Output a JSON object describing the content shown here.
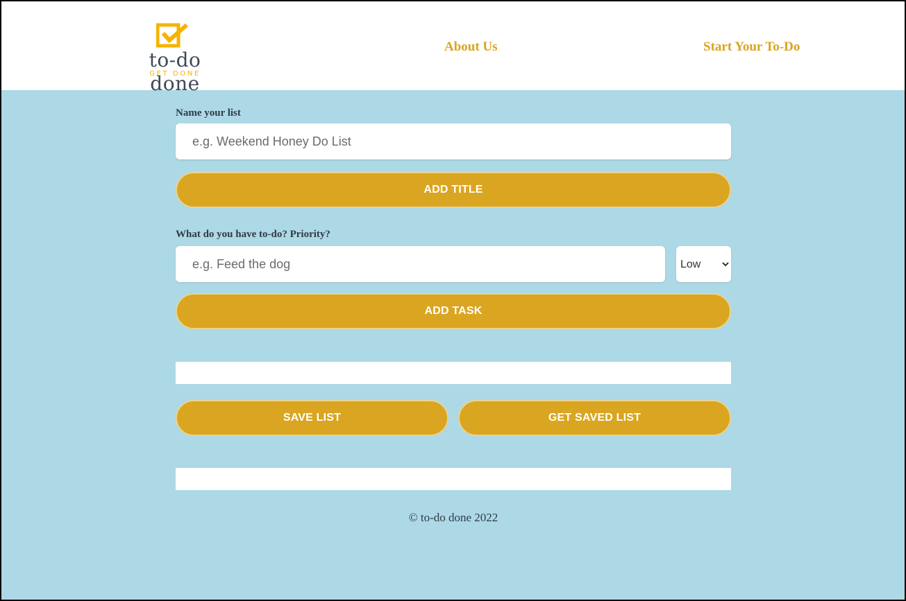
{
  "header": {
    "logo": {
      "name": "to-do done",
      "tagline": "GET DONE",
      "color_mark": "#f5b400"
    },
    "nav": [
      {
        "label": "About Us"
      },
      {
        "label": "Start Your To-Do"
      }
    ]
  },
  "form": {
    "title_section": {
      "label": "Name your list",
      "placeholder": "e.g. Weekend Honey Do List",
      "value": "",
      "button": "ADD TITLE"
    },
    "task_section": {
      "label": "What do you have to-do? Priority?",
      "placeholder": "e.g. Feed the dog",
      "value": "",
      "priority_selected": "Low",
      "button": "ADD TASK"
    },
    "save_button": "SAVE LIST",
    "get_saved_button": "GET SAVED LIST"
  },
  "footer": {
    "text": "© to-do done 2022"
  },
  "colors": {
    "background": "#add8e6",
    "accent": "#daa520",
    "link": "#d9a422"
  }
}
